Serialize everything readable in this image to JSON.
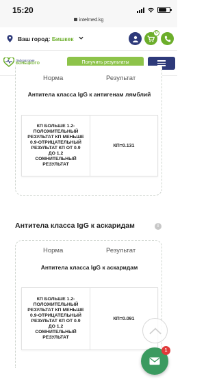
{
  "status_bar": {
    "time": "15:20"
  },
  "browser": {
    "url": "intelmed.kg"
  },
  "city_bar": {
    "label": "Ваш город:",
    "city": "Бишкек",
    "cart_count": "0"
  },
  "header": {
    "logo_line1": "Лаборатория",
    "logo_line2": "БОНЕЦКОГО",
    "results_button": "Получить результаты"
  },
  "tests": [
    {
      "section_title": "",
      "col_norm": "Норма",
      "col_result": "Результат",
      "table_title": "Антитела класса IgG к антигенам лямблий",
      "reference": "КП БОЛЬШЕ 1.2-ПОЛОЖИТЕЛЬНЫЙ РЕЗУЛЬТАТ КП МЕНЬШЕ 0.9-ОТРИЦАТЕЛЬНЫЙ РЕЗУЛЬТАТ КП ОТ 0.9 ДО 1.2 СОМНИТЕЛЬНЫЙ РЕЗУЛЬТАТ",
      "value": "КП=0.131"
    },
    {
      "section_title": "Антитела класса IgG к аскаридам",
      "col_norm": "Норма",
      "col_result": "Результат",
      "table_title": "Антитела класса IgG к аскаридам",
      "reference": "КП БОЛЬШЕ 1.2-ПОЛОЖИТЕЛЬНЫЙ РЕЗУЛЬТАТ КП МЕНЬШЕ 0.9-ОТРИЦАТЕЛЬНЫЙ РЕЗУЛЬТАТ КП ОТ 0.9 ДО 1.2 СОМНИТЕЛЬНЫЙ РЕЗУЛЬТАТ",
      "value": "КП=0.091"
    }
  ],
  "chat": {
    "badge": "1"
  },
  "icons": {
    "location": "location-pin-icon",
    "chevron": "chevron-down-icon",
    "user": "user-icon",
    "cart": "cart-icon",
    "phone": "phone-icon",
    "menu": "hamburger-menu-icon",
    "info": "info-icon",
    "scroll_top": "chevron-up-icon",
    "chat": "mail-icon"
  },
  "colors": {
    "brand_green": "#6cae2b",
    "brand_navy": "#2e3a7a",
    "results_button": "#8dc34a",
    "chat_button": "#3a9a5f",
    "badge_red": "#e03a3a"
  }
}
